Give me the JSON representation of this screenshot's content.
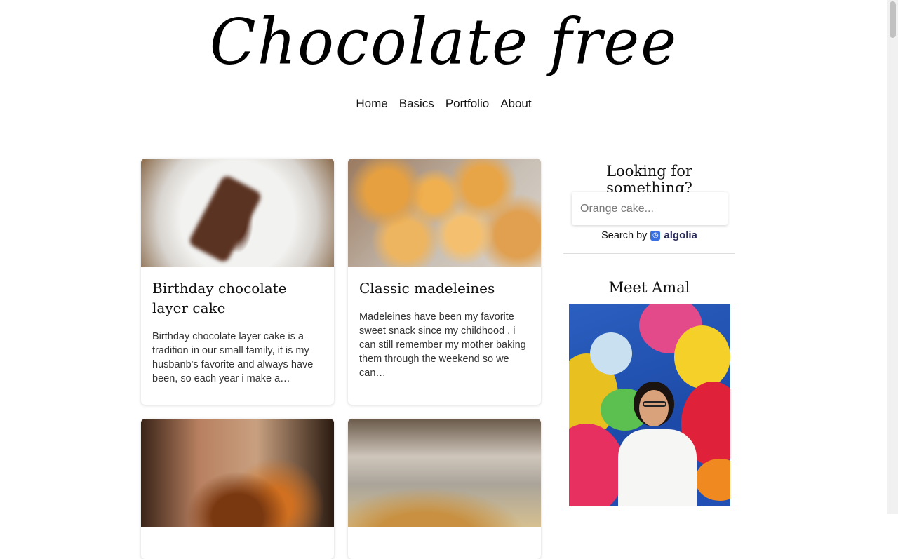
{
  "site": {
    "logo_text": "Chocolate free"
  },
  "nav": {
    "items": [
      {
        "label": "Home"
      },
      {
        "label": "Basics"
      },
      {
        "label": "Portfolio"
      },
      {
        "label": "About"
      }
    ]
  },
  "posts": [
    {
      "title": "Birthday chocolate layer cake",
      "excerpt": "Birthday chocolate layer cake is a tradition in our small family, it is my husbanb's favorite and always have been, so each year i make a…"
    },
    {
      "title": "Classic madeleines",
      "excerpt": "Madeleines have been my favorite sweet snack since my childhood , i can still remember my mother baking them through the weekend so we can…"
    }
  ],
  "sidebar": {
    "search_title": "Looking for something?",
    "search_placeholder": "Orange cake...",
    "search_by_label": "Search by",
    "search_provider": "algolia",
    "meet_title": "Meet Amal"
  },
  "colors": {
    "algolia_brand": "#3a6fe2",
    "portrait_background": "#2350b5"
  }
}
